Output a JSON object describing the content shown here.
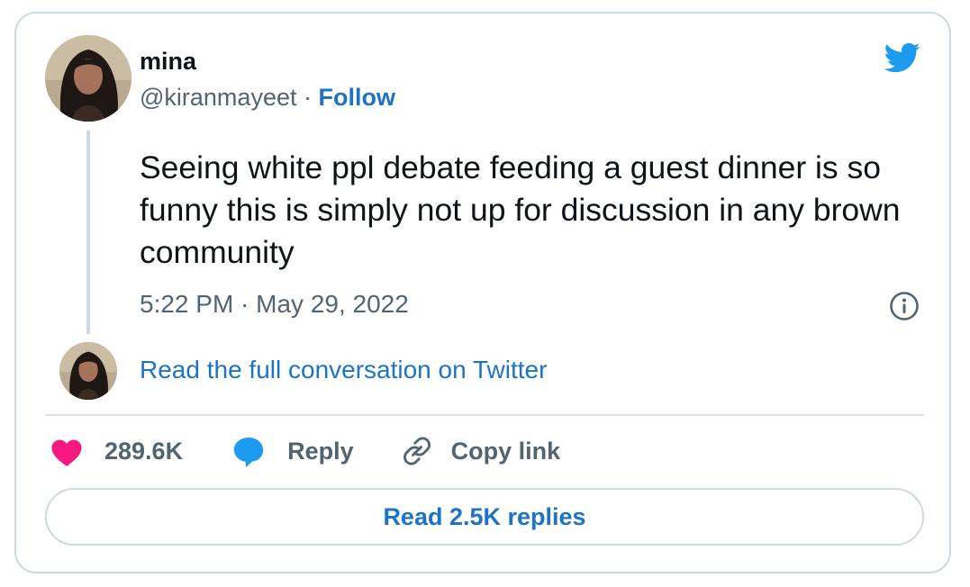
{
  "user": {
    "name": "mina",
    "handle": "@kiranmayeet",
    "separator": "·",
    "follow_label": "Follow"
  },
  "tweet": {
    "text": "Seeing white ppl debate feeding a guest dinner is so funny this is simply not up for discussion in any brown community",
    "timestamp": "5:22 PM · May 29, 2022"
  },
  "conversation_link": "Read the full conversation on Twitter",
  "actions": {
    "likes": "289.6K",
    "reply_label": "Reply",
    "copy_link_label": "Copy link"
  },
  "replies_button": "Read 2.5K replies",
  "icons": {
    "brand": "twitter-bird-icon",
    "info": "info-icon",
    "like": "heart-icon",
    "reply": "speech-bubble-icon",
    "copy": "link-icon"
  },
  "colors": {
    "twitter_blue": "#1d9bf0",
    "link_blue": "#1d73c8",
    "like_pink": "#f91880",
    "border": "#cfd9de",
    "muted_text": "#536471"
  }
}
